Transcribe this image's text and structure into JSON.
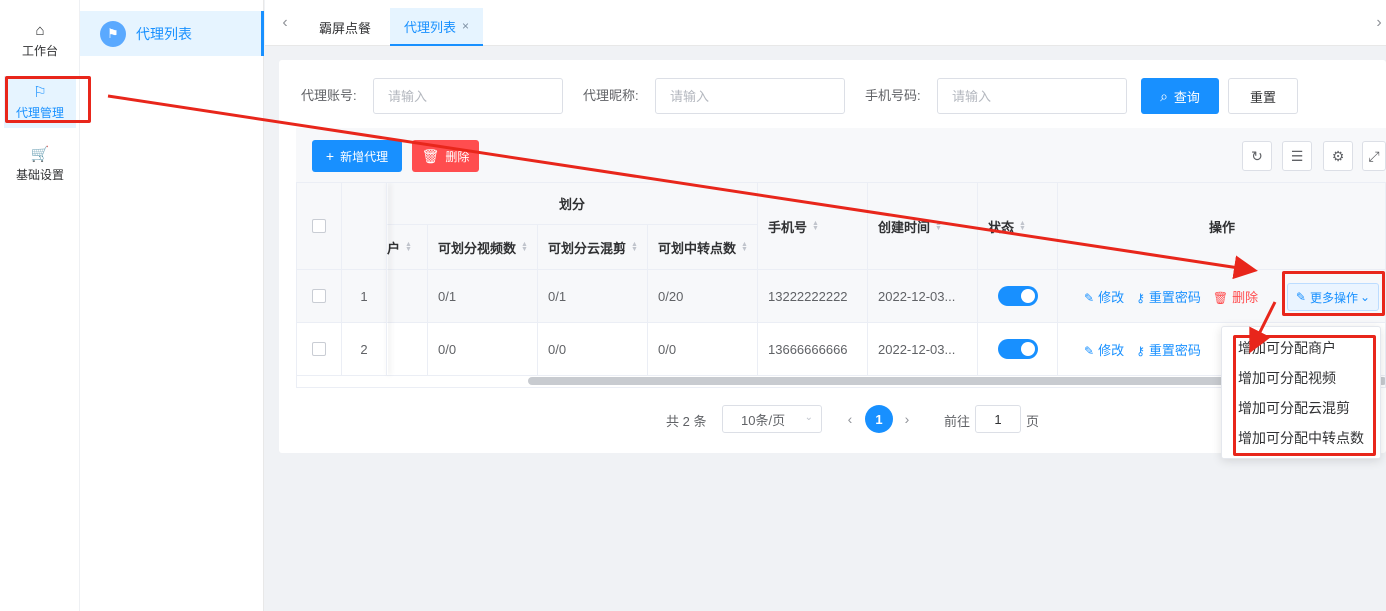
{
  "rail": [
    {
      "label": "工作台",
      "icon": "home-icon"
    },
    {
      "label": "代理管理",
      "icon": "flag-icon"
    },
    {
      "label": "基础设置",
      "icon": "cart-icon"
    }
  ],
  "submenu": {
    "label": "代理列表",
    "icon": "flag-icon"
  },
  "tabs": [
    {
      "label": "霸屏点餐"
    },
    {
      "label": "代理列表",
      "close": "×"
    }
  ],
  "search": {
    "account_label": "代理账号:",
    "nickname_label": "代理昵称:",
    "phone_label": "手机号码:",
    "placeholder": "请输入",
    "query_button": "查询",
    "reset_button": "重置"
  },
  "toolbar": {
    "add_button": "新增代理",
    "delete_button": "删除"
  },
  "table": {
    "group_header": "划分",
    "columns": {
      "merchant_partial": "户",
      "video": "可划分视频数",
      "cloud": "可划分云混剪",
      "relay": "可划中转点数",
      "phone": "手机号",
      "created": "创建时间",
      "status": "状态",
      "actions": "操作"
    },
    "rows": [
      {
        "index": "1",
        "video": "0/1",
        "cloud": "0/1",
        "relay": "0/20",
        "phone": "13222222222",
        "created": "2022-12-03...",
        "status_on": true
      },
      {
        "index": "2",
        "video": "0/0",
        "cloud": "0/0",
        "relay": "0/0",
        "phone": "13666666666",
        "created": "2022-12-03...",
        "status_on": true
      }
    ],
    "actions": {
      "edit": "修改",
      "reset_password": "重置密码",
      "delete": "删除",
      "more": "更多操作"
    }
  },
  "pagination": {
    "total": "共 2 条",
    "page_size": "10条/页",
    "current_page": "1",
    "goto_label": "前往",
    "goto_value": "1",
    "page_suffix": "页"
  },
  "dropdown": [
    "增加可分配商户",
    "增加可分配视频",
    "增加可分配云混剪",
    "增加可分配中转点数"
  ],
  "colors": {
    "primary": "#1890ff",
    "danger": "#ff4d4f",
    "annotation": "#e8261b"
  }
}
